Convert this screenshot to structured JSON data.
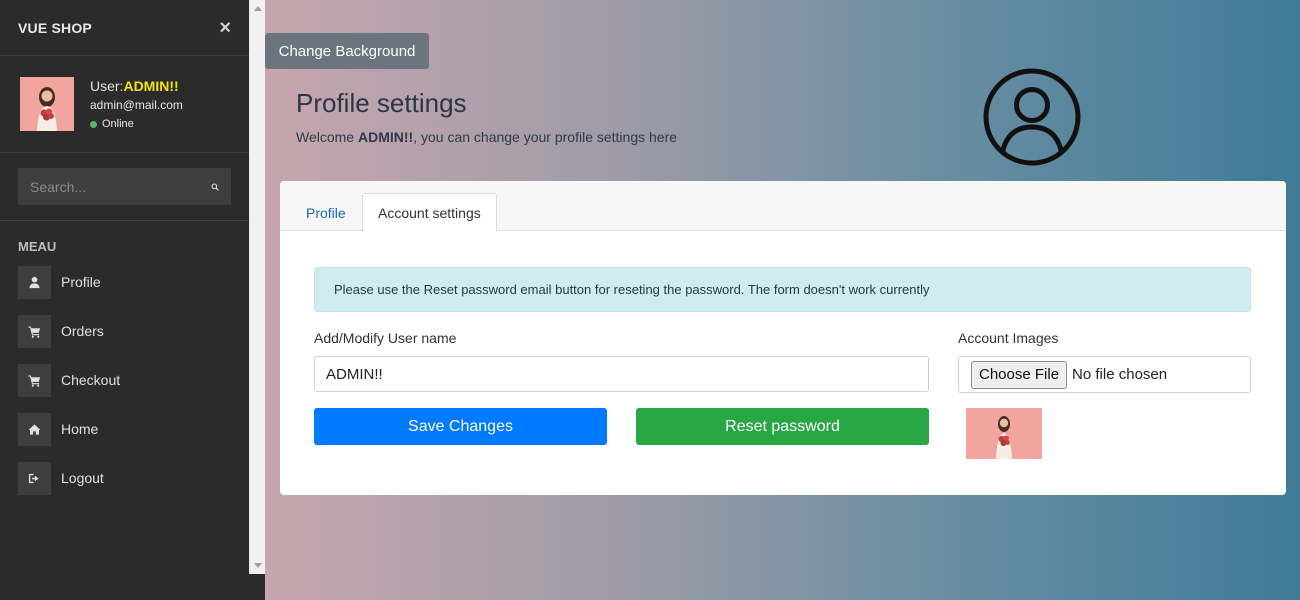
{
  "sidebar": {
    "brand": "VUE SHOP",
    "close_symbol": "×",
    "user": {
      "prefix": "User:",
      "name": "ADMIN!!",
      "email": "admin@mail.com",
      "status": "Online"
    },
    "search": {
      "placeholder": "Search..."
    },
    "menu_title": "MEAU",
    "items": [
      {
        "label": "Profile",
        "icon": "user-icon"
      },
      {
        "label": "Orders",
        "icon": "cart-icon"
      },
      {
        "label": "Checkout",
        "icon": "cart-icon"
      },
      {
        "label": "Home",
        "icon": "home-icon"
      },
      {
        "label": "Logout",
        "icon": "logout-icon"
      }
    ]
  },
  "main": {
    "change_background_label": "Change Background",
    "title": "Profile settings",
    "welcome": {
      "before": "Welcome ",
      "name": "ADMIN!!",
      "after": ", you can change your profile settings here"
    },
    "tabs": [
      {
        "label": "Profile",
        "active": false
      },
      {
        "label": "Account settings",
        "active": true
      }
    ],
    "alert": "Please use the Reset password email button for reseting the password. The form doesn't work currently",
    "username": {
      "label": "Add/Modify User name",
      "value": "ADMIN!!"
    },
    "buttons": {
      "save": "Save Changes",
      "reset": "Reset password"
    },
    "account_images": {
      "label": "Account Images",
      "choose_file": "Choose File",
      "status": "No file chosen"
    }
  },
  "colors": {
    "sidebar_bg": "#2b2b2b",
    "username_highlight": "#f5e400",
    "save_button": "#007bff",
    "reset_button": "#28a745",
    "secondary_button": "#6c757d",
    "alert_bg": "#d1ecf1"
  }
}
